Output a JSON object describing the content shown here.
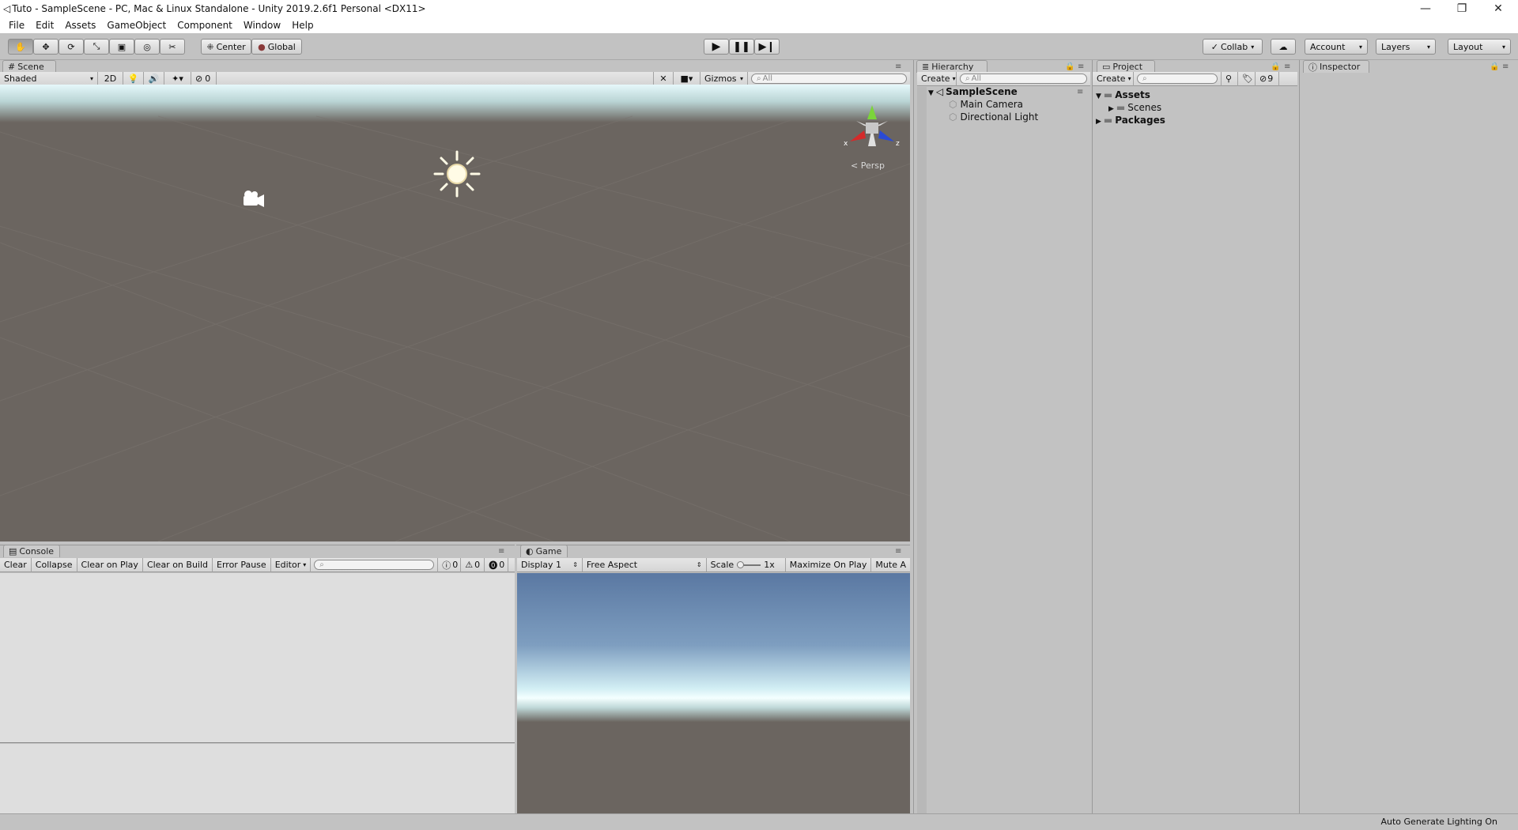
{
  "window": {
    "title": "Tuto - SampleScene - PC, Mac & Linux Standalone - Unity 2019.2.6f1 Personal <DX11>",
    "minimize": "—",
    "maximize": "❐",
    "close": "✕"
  },
  "menu": [
    "File",
    "Edit",
    "Assets",
    "GameObject",
    "Component",
    "Window",
    "Help"
  ],
  "toolbar": {
    "pivot": "Center",
    "space": "Global",
    "collab": "Collab",
    "account": "Account",
    "layers": "Layers",
    "layout": "Layout"
  },
  "scene": {
    "tab": "Scene",
    "shading": "Shaded",
    "mode2d": "2D",
    "fx_count": "0",
    "gizmos": "Gizmos",
    "search_placeholder": "All",
    "persp": "Persp",
    "axis_x": "x",
    "axis_z": "z",
    "colors": {
      "sky": "#d8f0f6",
      "ground": "#6b6560"
    }
  },
  "hierarchy": {
    "tab": "Hierarchy",
    "create": "Create",
    "search_placeholder": "All",
    "scene_name": "SampleScene",
    "items": [
      "Main Camera",
      "Directional Light"
    ]
  },
  "project": {
    "tab": "Project",
    "create": "Create",
    "count": "9",
    "tree": [
      {
        "label": "Assets",
        "bold": true
      },
      {
        "label": "Scenes",
        "bold": false
      },
      {
        "label": "Packages",
        "bold": true
      }
    ]
  },
  "inspector": {
    "tab": "Inspector"
  },
  "console": {
    "tab": "Console",
    "buttons": [
      "Clear",
      "Collapse",
      "Clear on Play",
      "Clear on Build",
      "Error Pause",
      "Editor"
    ],
    "counts": {
      "info": "0",
      "warn": "0",
      "error": "0"
    }
  },
  "game": {
    "tab": "Game",
    "display": "Display 1",
    "aspect": "Free Aspect",
    "scale_label": "Scale",
    "scale_value": "1x",
    "maximize": "Maximize On Play",
    "mute": "Mute A"
  },
  "status": {
    "text": "Auto Generate Lighting On"
  }
}
